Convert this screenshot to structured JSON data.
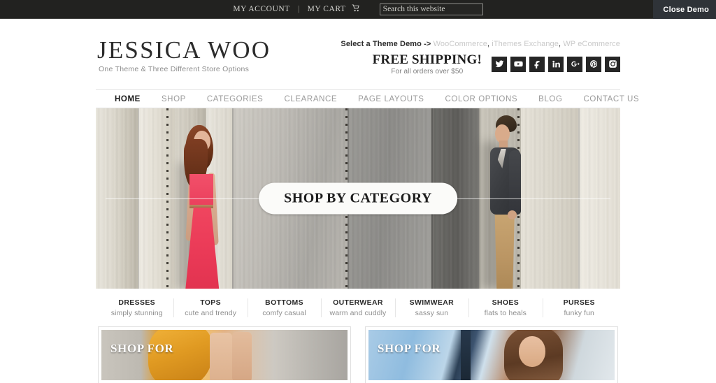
{
  "topbar": {
    "my_account": "MY ACCOUNT",
    "separator": "|",
    "my_cart": "MY CART",
    "cart_icon": "shopping-cart-icon",
    "search_placeholder": "Search this website",
    "search_value": "",
    "close_demo": "Close Demo",
    "bg_color": "#222220",
    "close_demo_bg": "#2f3338"
  },
  "header": {
    "brand_title": "JESSICA WOO",
    "brand_tagline": "One Theme & Three Different Store Options",
    "demo_prefix": "Select a Theme Demo ->",
    "demo_links": [
      {
        "label": "WooCommerce"
      },
      {
        "label": "iThemes Exchange"
      },
      {
        "label": "WP eCommerce"
      }
    ],
    "demo_link_color": "#c9c9c9",
    "shipping_title": "FREE SHIPPING!",
    "shipping_sub": "For all orders over $50",
    "socials": [
      {
        "name": "twitter-icon",
        "label": "Twitter"
      },
      {
        "name": "youtube-icon",
        "label": "YouTube"
      },
      {
        "name": "facebook-icon",
        "label": "Facebook"
      },
      {
        "name": "linkedin-icon",
        "label": "LinkedIn"
      },
      {
        "name": "googleplus-icon",
        "label": "Google Plus"
      },
      {
        "name": "pinterest-icon",
        "label": "Pinterest"
      },
      {
        "name": "instagram-icon",
        "label": "Instagram"
      }
    ]
  },
  "nav": {
    "items": [
      {
        "label": "HOME",
        "active": true
      },
      {
        "label": "SHOP",
        "active": false
      },
      {
        "label": "CATEGORIES",
        "active": false
      },
      {
        "label": "CLEARANCE",
        "active": false
      },
      {
        "label": "PAGE LAYOUTS",
        "active": false
      },
      {
        "label": "COLOR OPTIONS",
        "active": false
      },
      {
        "label": "BLOG",
        "active": false
      },
      {
        "label": "CONTACT US",
        "active": false
      }
    ]
  },
  "hero": {
    "cta_label": "SHOP BY CATEGORY",
    "description": "Woman in coral maxi dress and man in grey jacket with tan pants against a weathered wall"
  },
  "categories": [
    {
      "title": "DRESSES",
      "sub": "simply stunning"
    },
    {
      "title": "TOPS",
      "sub": "cute and trendy"
    },
    {
      "title": "BOTTOMS",
      "sub": "comfy casual"
    },
    {
      "title": "OUTERWEAR",
      "sub": "warm and cuddly"
    },
    {
      "title": "SWIMWEAR",
      "sub": "sassy sun"
    },
    {
      "title": "SHOES",
      "sub": "flats to heals"
    },
    {
      "title": "PURSES",
      "sub": "funky fun"
    }
  ],
  "promos": [
    {
      "label": "SHOP FOR"
    },
    {
      "label": "SHOP FOR"
    }
  ]
}
